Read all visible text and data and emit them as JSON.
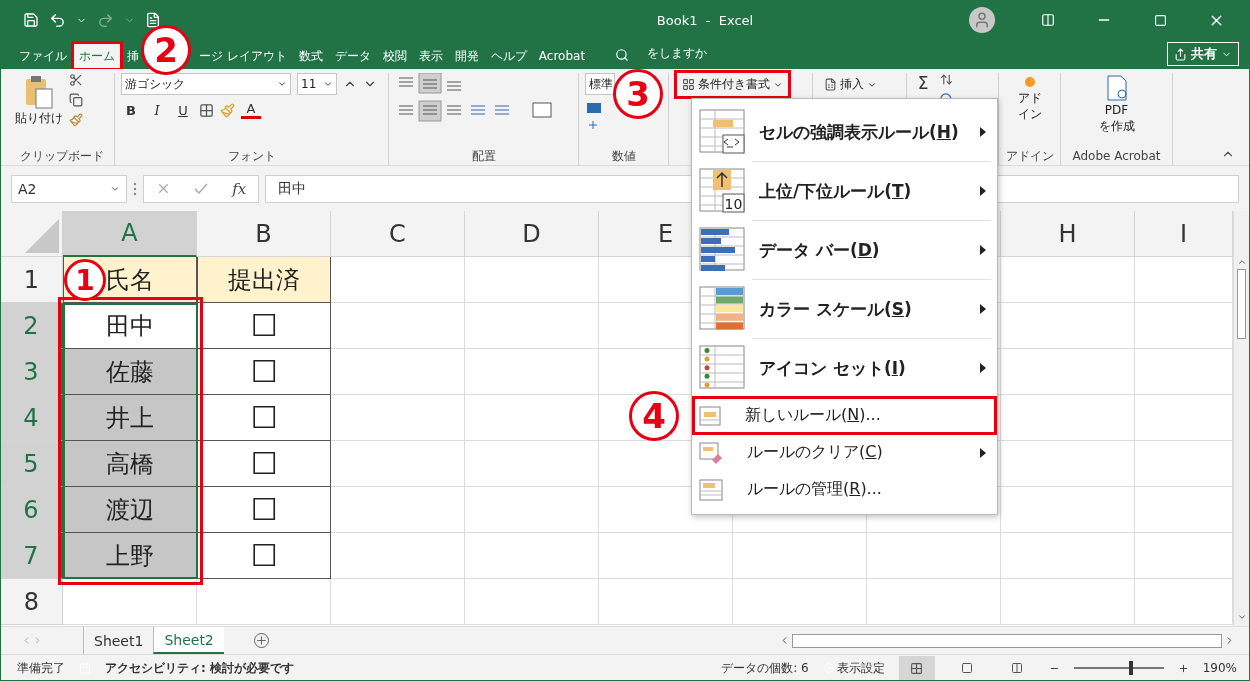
{
  "window": {
    "title": "Book1  -  Excel",
    "share_label": "共有"
  },
  "menu_tabs": [
    {
      "label": "ファイル",
      "selected": false,
      "highlighted": false
    },
    {
      "label": "ホーム",
      "selected": true,
      "highlighted": true
    },
    {
      "label": "挿",
      "selected": false,
      "highlighted": false
    },
    {
      "label": "ージ レイアウト",
      "selected": false,
      "highlighted": false
    },
    {
      "label": "数式",
      "selected": false,
      "highlighted": false
    },
    {
      "label": "データ",
      "selected": false,
      "highlighted": false
    },
    {
      "label": "校閲",
      "selected": false,
      "highlighted": false
    },
    {
      "label": "表示",
      "selected": false,
      "highlighted": false
    },
    {
      "label": "開発",
      "selected": false,
      "highlighted": false
    },
    {
      "label": "ヘルプ",
      "selected": false,
      "highlighted": false
    },
    {
      "label": "Acrobat",
      "selected": false,
      "highlighted": false
    }
  ],
  "tell_me": "をしますか",
  "ribbon": {
    "clipboard": {
      "paste": "貼り付け",
      "label": "クリップボード"
    },
    "font": {
      "name": "游ゴシック",
      "size": "11",
      "bold": "B",
      "italic": "I",
      "underline": "U",
      "color_letter": "A",
      "label": "フォント"
    },
    "alignment": {
      "label": "配置"
    },
    "number": {
      "format": "標準",
      "label": "数値"
    },
    "styles": {
      "conditional_format": "条件付き書式",
      "highlighted": true
    },
    "cells": {
      "insert": "挿入"
    },
    "editing": {
      "sum": "Σ"
    },
    "addins": {
      "button_lines": [
        "アド",
        "イン"
      ],
      "label": "アドイン"
    },
    "adobe": {
      "button_lines": [
        "PDF",
        "を作成"
      ],
      "label": "Adobe Acrobat"
    }
  },
  "formula_bar": {
    "name_box": "A2",
    "fx": "fx",
    "value": "田中"
  },
  "sheet": {
    "columns_left": [
      "A",
      "B",
      "C",
      "D",
      "E"
    ],
    "columns_right": [
      "H",
      "I"
    ],
    "range_outlined": true,
    "rows": [
      {
        "number": "1",
        "kind": "heading",
        "name": "氏名",
        "status": "提出済",
        "selected": false,
        "active": false
      },
      {
        "number": "2",
        "kind": "entry",
        "name": "田中",
        "box": "☐",
        "selected": true,
        "active": true
      },
      {
        "number": "3",
        "kind": "entry",
        "name": "佐藤",
        "box": "☐",
        "selected": true,
        "active": false
      },
      {
        "number": "4",
        "kind": "entry",
        "name": "井上",
        "box": "☐",
        "selected": true,
        "active": false
      },
      {
        "number": "5",
        "kind": "entry",
        "name": "高橋",
        "box": "☐",
        "selected": true,
        "active": false
      },
      {
        "number": "6",
        "kind": "entry",
        "name": "渡辺",
        "box": "☐",
        "selected": true,
        "active": false
      },
      {
        "number": "7",
        "kind": "entry",
        "name": "上野",
        "box": "☐",
        "selected": true,
        "active": false
      },
      {
        "number": "8",
        "kind": "empty",
        "selected": false,
        "active": false
      }
    ]
  },
  "dropdown_menu": [
    {
      "kind": "large",
      "label": "セルの強調表示ルール(",
      "key": "H",
      "tail": ")",
      "submenu": true,
      "highlighted": false
    },
    {
      "kind": "large",
      "icon_text": "10",
      "label": "上位/下位ルール(",
      "key": "T",
      "tail": ")",
      "submenu": true,
      "highlighted": false
    },
    {
      "kind": "large",
      "label": "データ バー(",
      "key": "D",
      "tail": ")",
      "submenu": true,
      "highlighted": false
    },
    {
      "kind": "large",
      "label": "カラー スケール(",
      "key": "S",
      "tail": ")",
      "submenu": true,
      "highlighted": false
    },
    {
      "kind": "large",
      "label": "アイコン セット(",
      "key": "I",
      "tail": ")",
      "submenu": true,
      "highlighted": false
    },
    {
      "kind": "small",
      "label": "新しいルール(",
      "key": "N",
      "tail": ")...",
      "submenu": false,
      "highlighted": true
    },
    {
      "kind": "small",
      "label": "ルールのクリア(",
      "key": "C",
      "tail": ")",
      "submenu": true,
      "highlighted": false
    },
    {
      "kind": "small",
      "label": "ルールの管理(",
      "key": "R",
      "tail": ")...",
      "submenu": false,
      "highlighted": false
    }
  ],
  "callouts": [
    {
      "number": "1"
    },
    {
      "number": "2"
    },
    {
      "number": "3"
    },
    {
      "number": "4"
    }
  ],
  "sheet_tabs": [
    {
      "label": "Sheet1",
      "selected": false
    },
    {
      "label": "Sheet2",
      "selected": true
    }
  ],
  "status_bar": {
    "ready": "準備完了",
    "accessibility": "アクセシビリティ: 検討が必要です",
    "count": "データの個数: 6",
    "display_settings": "表示設定",
    "zoom": "190%",
    "zoom_slider": {
      "level": 0.62
    }
  }
}
